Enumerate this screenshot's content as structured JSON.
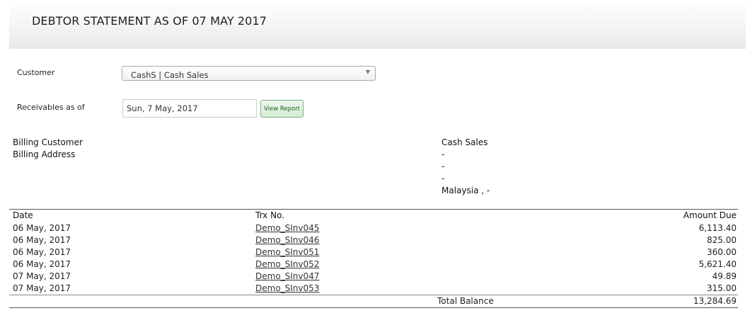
{
  "header": {
    "title": "DEBTOR STATEMENT AS OF 07 MAY 2017"
  },
  "form": {
    "customer_label": "Customer",
    "customer_value": "CashS | Cash Sales",
    "receivables_label": "Receivables as of",
    "receivables_value": "Sun, 7 May, 2017",
    "view_report_label": "View Report"
  },
  "billing": {
    "customer_label": "Billing Customer",
    "address_label": "Billing Address",
    "customer_name": "Cash Sales",
    "address_lines": [
      "-",
      "-",
      "-",
      "Malaysia , -"
    ]
  },
  "table": {
    "headers": {
      "date": "Date",
      "trx": "Trx No.",
      "amount": "Amount Due"
    },
    "rows": [
      {
        "date": "06 May, 2017",
        "trx": "Demo_SInv045",
        "amount": "6,113.40"
      },
      {
        "date": "06 May, 2017",
        "trx": "Demo_SInv046",
        "amount": "825.00"
      },
      {
        "date": "06 May, 2017",
        "trx": "Demo_SInv051",
        "amount": "360.00"
      },
      {
        "date": "06 May, 2017",
        "trx": "Demo_SInv052",
        "amount": "5,621.40"
      },
      {
        "date": "07 May, 2017",
        "trx": "Demo_SInv047",
        "amount": "49.89"
      },
      {
        "date": "07 May, 2017",
        "trx": "Demo_SInv053",
        "amount": "315.00"
      }
    ],
    "total_label": "Total Balance",
    "total_value": "13,284.69"
  }
}
